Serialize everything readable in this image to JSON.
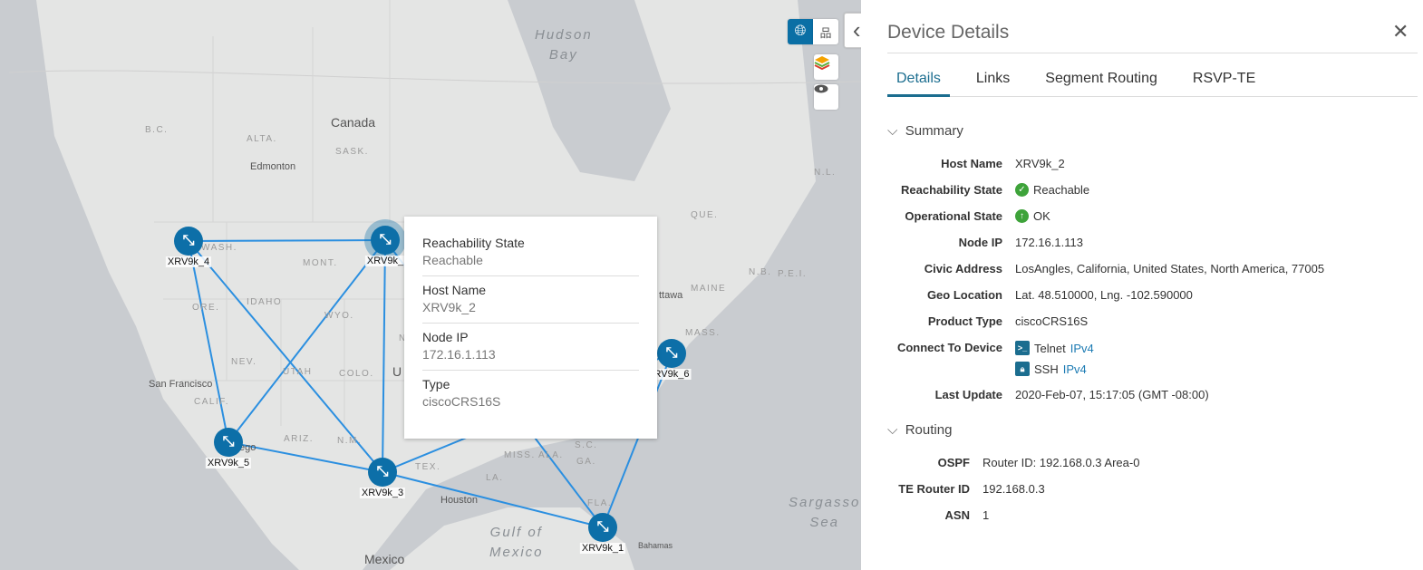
{
  "map": {
    "labels": {
      "hudson": "Hudson\nBay",
      "canada": "Canada",
      "bc": "B.C.",
      "alta": "ALTA.",
      "sask": "SASK.",
      "edmonton": "Edmonton",
      "wash": "WASH.",
      "mont": "MONT.",
      "idaho": "IDAHO",
      "ore": "ORE.",
      "wyo": "WYO.",
      "nev": "NEV.",
      "utah": "UTAH",
      "colo": "COLO.",
      "sf": "San Francisco",
      "calif": "CALIF.",
      "arizona": "ARIZ.",
      "nm": "N.M.",
      "tex": "TEX.",
      "la": "LA.",
      "miss": "MISS.",
      "ala": "ALA.",
      "ga": "GA.",
      "sc": "S.C.",
      "fla": "FLA.",
      "houston": "Houston",
      "gulf": "Gulf of\nMexico",
      "mexico": "Mexico",
      "sargasso": "Sargasso\nSea",
      "bahamas": "Bahamas",
      "que": "QUE.",
      "nl": "N.L.",
      "maine": "MAINE",
      "ottawa": "ttawa",
      "nb": "N.B.",
      "pei": "P.E.I.",
      "mass": "MASS.",
      "ego": "ego",
      "u": "U",
      "nl2": "N"
    },
    "nodes": [
      {
        "id": "XRV9k_4",
        "label": "XRV9k_4"
      },
      {
        "id": "XRV9k_2",
        "label": "XRV9k_",
        "selected": true
      },
      {
        "id": "XRV9k_5",
        "label": "XRV9k_5"
      },
      {
        "id": "XRV9k_3",
        "label": "XRV9k_3"
      },
      {
        "id": "XRV9k_1",
        "label": "XRV9k_1"
      },
      {
        "id": "XRV9k_6",
        "label": "RV9k_6"
      }
    ],
    "links": [
      [
        "XRV9k_4",
        "XRV9k_2"
      ],
      [
        "XRV9k_4",
        "XRV9k_5"
      ],
      [
        "XRV9k_4",
        "XRV9k_3"
      ],
      [
        "XRV9k_2",
        "XRV9k_5"
      ],
      [
        "XRV9k_2",
        "XRV9k_3"
      ],
      [
        "XRV9k_5",
        "XRV9k_3"
      ],
      [
        "XRV9k_3",
        "XRV9k_1"
      ],
      [
        "XRV9k_3",
        "XRV9k_6"
      ],
      [
        "XRV9k_2",
        "XRV9k_1"
      ],
      [
        "XRV9k_6",
        "XRV9k_1"
      ]
    ],
    "link_color": "#2b8fe0",
    "node_color": "#0d6fa8",
    "tooltip": [
      {
        "key": "Reachability State",
        "value": "Reachable"
      },
      {
        "key": "Host Name",
        "value": "XRV9k_2"
      },
      {
        "key": "Node IP",
        "value": "172.16.1.113"
      },
      {
        "key": "Type",
        "value": "ciscoCRS16S"
      }
    ],
    "controls": {
      "globe": "globe-icon",
      "topology": "topology-icon",
      "layers": "layers-icon",
      "eye": "eye-icon"
    }
  },
  "panel": {
    "title": "Device Details",
    "tabs": [
      "Details",
      "Links",
      "Segment Routing",
      "RSVP-TE"
    ],
    "active_tab": "Details",
    "summary_title": "Summary",
    "summary": {
      "host_name": {
        "k": "Host Name",
        "v": "XRV9k_2"
      },
      "reach": {
        "k": "Reachability State",
        "v": "Reachable"
      },
      "oper": {
        "k": "Operational State",
        "v": "OK"
      },
      "ip": {
        "k": "Node IP",
        "v": "172.16.1.113"
      },
      "civic": {
        "k": "Civic Address",
        "v": "LosAngles, California, United States, North America, 77005"
      },
      "geo": {
        "k": "Geo Location",
        "v": "Lat. 48.510000, Lng. -102.590000"
      },
      "product": {
        "k": "Product Type",
        "v": "ciscoCRS16S"
      },
      "connect": {
        "k": "Connect To Device",
        "telnet": "Telnet",
        "ssh": "SSH",
        "ipv4": "IPv4"
      },
      "update": {
        "k": "Last Update",
        "v": "2020-Feb-07, 15:17:05 (GMT -08:00)"
      }
    },
    "routing_title": "Routing",
    "routing": {
      "ospf": {
        "k": "OSPF",
        "v": "Router ID: 192.168.0.3 Area-0"
      },
      "te": {
        "k": "TE Router ID",
        "v": "192.168.0.3"
      },
      "asn": {
        "k": "ASN",
        "v": "1"
      }
    },
    "accent": "#1b6d8f"
  }
}
